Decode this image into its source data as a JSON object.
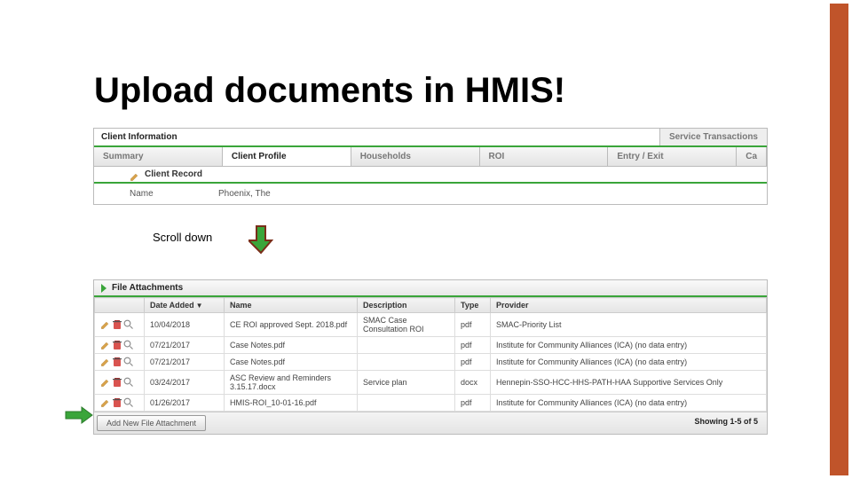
{
  "title": "Upload documents in HMIS!",
  "topbar": {
    "left": "Client Information",
    "right": "Service Transactions"
  },
  "tabs": {
    "summary": "Summary",
    "profile": "Client Profile",
    "households": "Households",
    "roi": "ROI",
    "entry": "Entry / Exit",
    "last": "Ca"
  },
  "record": {
    "label": "Client Record"
  },
  "namerow": {
    "label": "Name",
    "value": "Phoenix, The"
  },
  "scroll": "Scroll down",
  "files": {
    "header": "File Attachments",
    "cols": {
      "date": "Date Added",
      "name": "Name",
      "desc": "Description",
      "type": "Type",
      "provider": "Provider"
    },
    "rows": [
      {
        "date": "10/04/2018",
        "name": "CE ROI approved Sept. 2018.pdf",
        "desc": "SMAC Case Consultation ROI",
        "type": "pdf",
        "provider": "SMAC-Priority List"
      },
      {
        "date": "07/21/2017",
        "name": "Case Notes.pdf",
        "desc": "",
        "type": "pdf",
        "provider": "Institute for Community Alliances (ICA) (no data entry)"
      },
      {
        "date": "07/21/2017",
        "name": "Case Notes.pdf",
        "desc": "",
        "type": "pdf",
        "provider": "Institute for Community Alliances (ICA) (no data entry)"
      },
      {
        "date": "03/24/2017",
        "name": "ASC Review and Reminders 3.15.17.docx",
        "desc": "Service plan",
        "type": "docx",
        "provider": "Hennepin-SSO-HCC-HHS-PATH-HAA Supportive Services Only"
      },
      {
        "date": "01/26/2017",
        "name": "HMIS-ROI_10-01-16.pdf",
        "desc": "",
        "type": "pdf",
        "provider": "Institute for Community Alliances (ICA) (no data entry)"
      }
    ],
    "add": "Add New File Attachment",
    "showing": "Showing 1-5 of 5"
  }
}
